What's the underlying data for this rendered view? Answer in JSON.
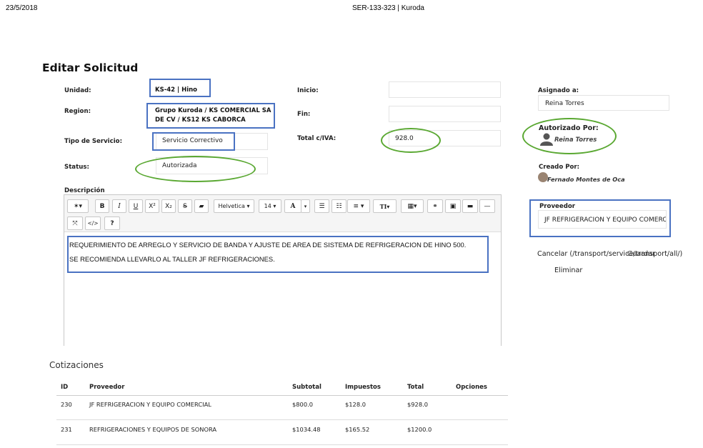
{
  "print_header": {
    "date": "23/5/2018",
    "title": "SER-133-323 | Kuroda"
  },
  "page": {
    "title": "Editar Solicitud"
  },
  "form": {
    "unidad_label": "Unidad:",
    "unidad_value": "KS-42 | Hino",
    "region_label": "Region:",
    "region_line1": "Grupo Kuroda / KS COMERCIAL SA",
    "region_line2": "DE CV / KS12 KS CABORCA",
    "tipo_label": "Tipo de Servicio:",
    "tipo_value": "Servicio Correctivo",
    "status_label": "Status:",
    "status_value": "Autorizada",
    "inicio_label": "Inicio:",
    "inicio_value": "",
    "fin_label": "Fin:",
    "fin_value": "",
    "total_label": "Total c/IVA:",
    "total_value": "928.0",
    "asignado_label": "Asignado a:",
    "asignado_value": "Reina Torres",
    "autorizado_label": "Autorizado Por:",
    "autorizado_value": "Reina Torres",
    "creado_label": "Creado Por:",
    "creado_value": "Fernado Montes de Oca",
    "proveedor_label": "Proveedor",
    "proveedor_value": "JF REFRIGERACION Y EQUIPO COMERCIAL",
    "descripcion_label": "Descripción"
  },
  "editor": {
    "toolbar": {
      "magic": "magic-wand-icon",
      "bold": "B",
      "italic": "I",
      "underline": "U",
      "superscript": "X²",
      "subscript": "X₂",
      "strike": "S",
      "eraser": "eraser-icon",
      "font_family": "Helvetica",
      "font_size": "14",
      "color": "A",
      "ul": "unordered-list-icon",
      "ol": "ordered-list-icon",
      "align": "align-icon",
      "line_height": "TI",
      "table": "table-icon",
      "link": "link-icon",
      "picture": "picture-icon",
      "video": "video-icon",
      "hr": "horizontal-rule-icon",
      "fullscreen": "fullscreen-icon",
      "codeview": "</>",
      "help": "?"
    },
    "content_line1": "REQUERIMIENTO DE ARREGLO Y SERVICIO DE BANDA Y AJUSTE DE AREA DE SISTEMA DE REFRIGERACION DE HINO 500.",
    "content_line2": "SE RECOMIENDA LLEVARLO AL TALLER JF REFRIGERACIONES."
  },
  "actions": {
    "cancel_text": "Cancelar (/transport/service/transport/all/)",
    "save_text": "Guardar",
    "delete_text": "Eliminar"
  },
  "quotes": {
    "title": "Cotizaciones",
    "columns": [
      "ID",
      "Proveedor",
      "Subtotal",
      "Impuestos",
      "Total",
      "Opciones"
    ],
    "rows": [
      {
        "id": "230",
        "proveedor": "JF REFRIGERACION Y EQUIPO COMERCIAL",
        "subtotal": "$800.0",
        "impuestos": "$128.0",
        "total": "$928.0",
        "opciones": ""
      },
      {
        "id": "231",
        "proveedor": "REFRIGERACIONES Y EQUIPOS DE SONORA",
        "subtotal": "$1034.48",
        "impuestos": "$165.52",
        "total": "$1200.0",
        "opciones": ""
      }
    ]
  },
  "colors": {
    "annotation_blue": "#4a72c2",
    "annotation_green": "#5aa832"
  }
}
